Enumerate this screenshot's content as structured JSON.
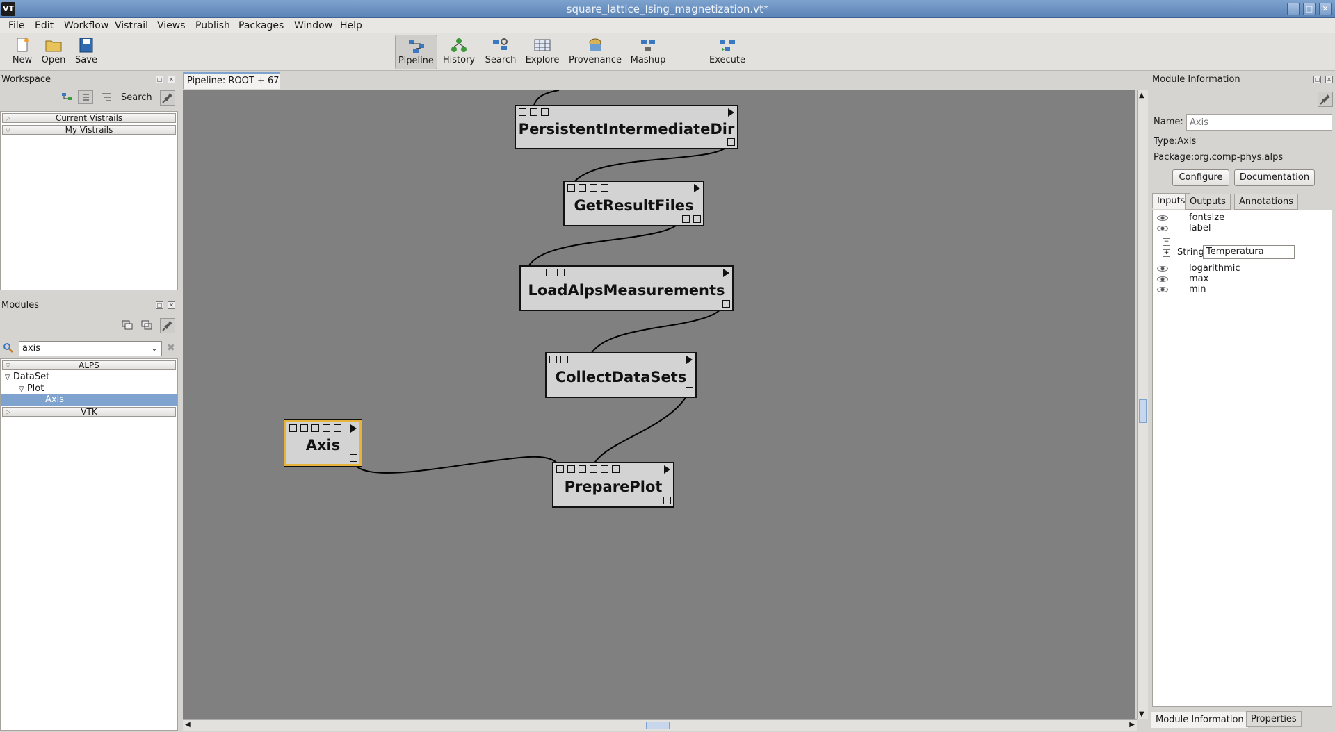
{
  "window": {
    "title": "square_lattice_Ising_magnetization.vt*",
    "logo": "VT"
  },
  "menu": [
    "File",
    "Edit",
    "Workflow",
    "Vistrail",
    "Views",
    "Publish",
    "Packages",
    "Window",
    "Help"
  ],
  "toolbar": {
    "new": "New",
    "open": "Open",
    "save": "Save",
    "pipeline": "Pipeline",
    "history": "History",
    "search": "Search",
    "explore": "Explore",
    "provenance": "Provenance",
    "mashup": "Mashup",
    "execute": "Execute"
  },
  "workspace": {
    "title": "Workspace",
    "search_label": "Search",
    "sections": [
      "Current Vistrails",
      "My Vistrails"
    ]
  },
  "modules_panel": {
    "title": "Modules",
    "search_value": "axis",
    "packages": [
      "ALPS",
      "VTK"
    ],
    "tree": {
      "dataset": "DataSet",
      "plot": "Plot",
      "axis": "Axis"
    }
  },
  "pipeline_tab": "Pipeline: ROOT + 67",
  "canvas": {
    "modules": {
      "persistent": "PersistentIntermediateDir",
      "getresult": "GetResultFiles",
      "loadalps": "LoadAlpsMeasurements",
      "collect": "CollectDataSets",
      "axis": "Axis",
      "prepare": "PreparePlot"
    }
  },
  "module_info": {
    "title": "Module Information",
    "name_label": "Name:",
    "name_placeholder": "Axis",
    "type_label": "Type:",
    "type_value": "Axis",
    "package_label": "Package:",
    "package_value": "org.comp-phys.alps",
    "configure": "Configure",
    "documentation": "Documentation",
    "tabs": [
      "Inputs",
      "Outputs",
      "Annotations"
    ],
    "inputs": [
      "fontsize",
      "label",
      "logarithmic",
      "max",
      "min"
    ],
    "string_label": "String",
    "string_value": "Temperatura",
    "bottom_tabs": [
      "Module Information",
      "Properties"
    ]
  },
  "colors": {
    "selection": "#7ea3cf",
    "canvas": "#808080",
    "selected_module_border": "#e6b43a"
  }
}
